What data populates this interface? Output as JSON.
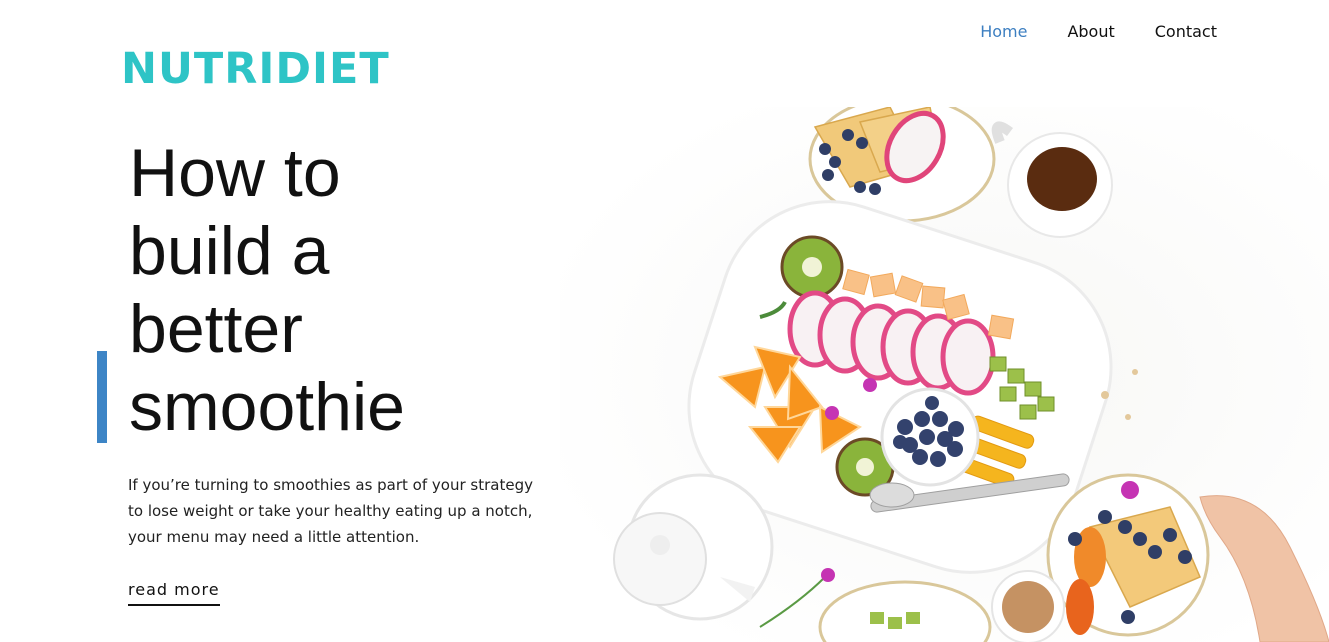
{
  "brand": {
    "logo": "NUTRIDIET"
  },
  "nav": {
    "items": [
      "Home",
      "About",
      "Contact"
    ],
    "active": "Home"
  },
  "hero": {
    "headline_lines": [
      "How to",
      "build a",
      "better",
      "smoothie"
    ],
    "intro": "If you’re turning to smoothies as part of your strategy to lose weight or take your healthy eating up a notch, your menu may need a little attention.",
    "cta": "read more",
    "image_alt": "Overhead photo of a breakfast table with a fruit platter, blueberries, crepes, and teapot"
  },
  "colors": {
    "brand": "#2ec4c6",
    "nav_active": "#3d7fc1",
    "accent_bar": "#3d85c6"
  }
}
